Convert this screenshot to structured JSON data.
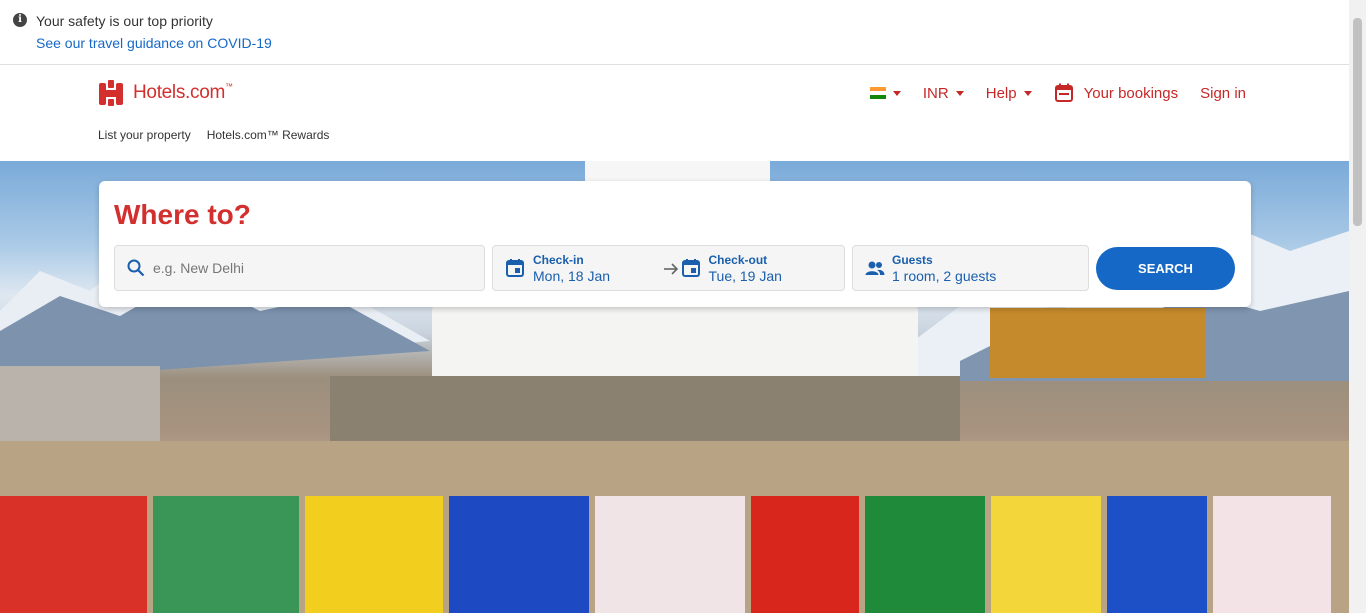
{
  "banner": {
    "title": "Your safety is our top priority",
    "link": "See our travel guidance on COVID-19",
    "icon": "info-icon"
  },
  "header": {
    "logo_text": "Hotels.com",
    "logo_tm": "™",
    "subnav": [
      "List your property",
      "Hotels.com™ Rewards"
    ],
    "currency": "INR",
    "help": "Help",
    "bookings": "Your bookings",
    "signin": "Sign in",
    "brand_color": "#d32f2f"
  },
  "search": {
    "heading": "Where to?",
    "destination_placeholder": "e.g. New Delhi",
    "destination_value": "",
    "checkin_label": "Check-in",
    "checkin_value": "Mon, 18 Jan",
    "checkout_label": "Check-out",
    "checkout_value": "Tue, 19 Jan",
    "guests_label": "Guests",
    "guests_value": "1 room, 2 guests",
    "button": "SEARCH",
    "accent_color": "#1668c7"
  }
}
